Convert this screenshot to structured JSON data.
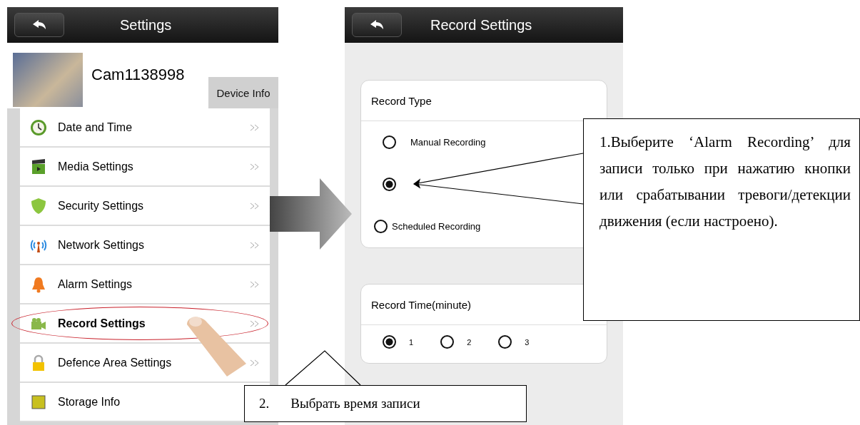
{
  "settings_screen": {
    "title": "Settings",
    "device_name": "Cam1138998",
    "device_info_button": "Device Info",
    "items": [
      {
        "label": "Date and Time",
        "selected": false
      },
      {
        "label": "Media Settings",
        "selected": false
      },
      {
        "label": "Security Settings",
        "selected": false
      },
      {
        "label": "Network Settings",
        "selected": false
      },
      {
        "label": "Alarm Settings",
        "selected": false
      },
      {
        "label": "Record Settings",
        "selected": true
      },
      {
        "label": "Defence Area Settings",
        "selected": false
      },
      {
        "label": "Storage Info",
        "selected": false
      }
    ]
  },
  "record_settings_screen": {
    "title": "Record Settings",
    "record_type": {
      "title": "Record Type",
      "options": [
        {
          "label": "Manual Recording",
          "selected": false
        },
        {
          "selected": true
        },
        {
          "label": "Scheduled Recording",
          "selected": false
        }
      ]
    },
    "record_time": {
      "title": "Record Time(minute)",
      "options": [
        {
          "label": "1",
          "selected": true
        },
        {
          "label": "2",
          "selected": false
        },
        {
          "label": "3",
          "selected": false
        }
      ]
    }
  },
  "callouts": [
    {
      "number": "1.",
      "text": "Выберите ‘Alarm Recording’ для записи только при нажатию кнопки или срабатывании тревоги/детекции движения (если настроено)."
    },
    {
      "number": "2.",
      "text": "Выбрать время записи"
    }
  ]
}
